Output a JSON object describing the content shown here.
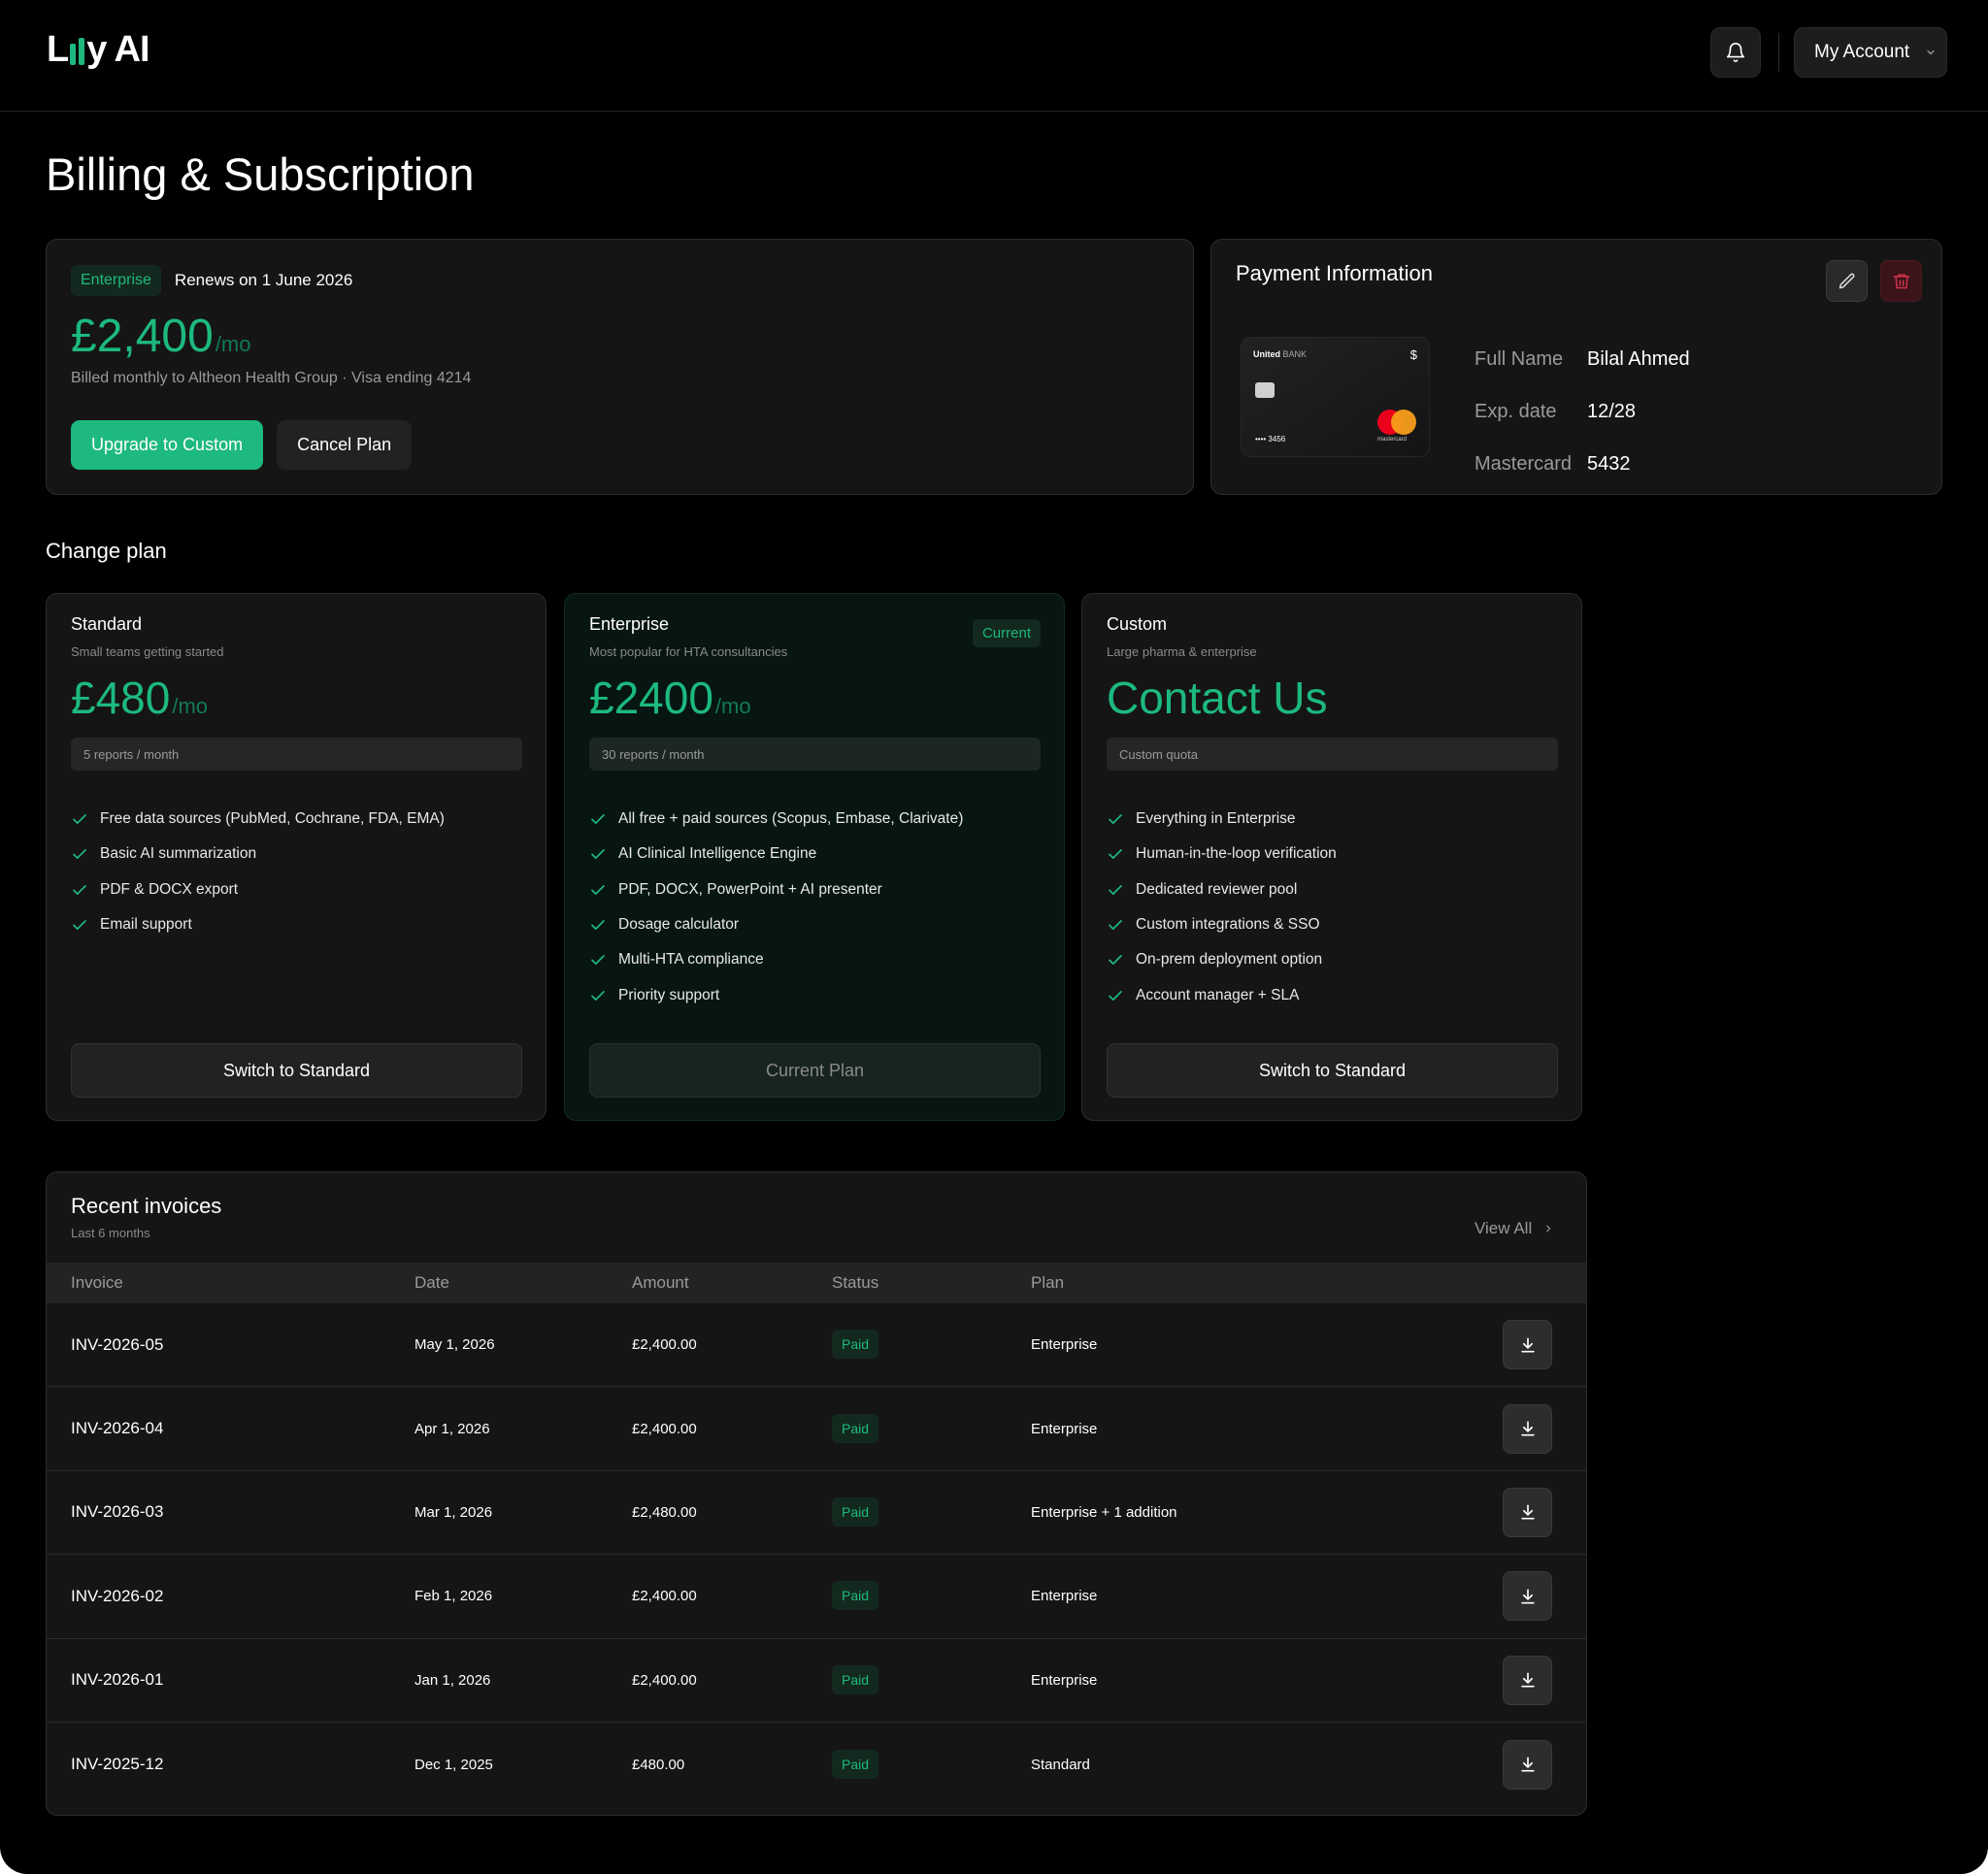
{
  "brand": {
    "name_pre": "L",
    "name_post": "y AI"
  },
  "header": {
    "account_label": "My Account",
    "bell_icon": "bell-icon",
    "chevron_icon": "chevron-down-icon"
  },
  "page_title": "Billing & Subscription",
  "subscription": {
    "plan_badge": "Enterprise",
    "renews": "Renews on 1 June 2026",
    "price": "£2,400",
    "unit": "/mo",
    "description": "Billed monthly to Altheon Health Group · Visa ending 4214",
    "upgrade_label": "Upgrade to Custom",
    "cancel_label": "Cancel Plan"
  },
  "payment": {
    "title": "Payment Information",
    "card": {
      "bank": "United",
      "bank_suffix": "BANK",
      "currency": "$",
      "masked": "•••• 3456",
      "network_text": "mastercard"
    },
    "rows": [
      {
        "label": "Full Name",
        "value": "Bilal Ahmed"
      },
      {
        "label": "Exp. date",
        "value": "12/28"
      },
      {
        "label": "Mastercard",
        "value": "5432"
      }
    ],
    "colors": {
      "accent": "#1db97f",
      "danger": "#d0324a"
    }
  },
  "change_plan": {
    "title": "Change plan",
    "plans": [
      {
        "name": "Standard",
        "subtitle": "Small teams getting started",
        "price": "£480",
        "unit": "/mo",
        "quota": "5 reports / month",
        "features": [
          "Free data sources (PubMed, Cochrane, FDA, EMA)",
          "Basic AI summarization",
          "PDF & DOCX export",
          "Email support"
        ],
        "button": "Switch to Standard"
      },
      {
        "name": "Enterprise",
        "subtitle": "Most popular for HTA consultancies",
        "badge": "Current",
        "price": "£2400",
        "unit": "/mo",
        "quota": "30 reports / month",
        "features": [
          "All free + paid sources (Scopus, Embase, Clarivate)",
          "AI Clinical Intelligence Engine",
          "PDF, DOCX, PowerPoint + AI presenter",
          "Dosage calculator",
          "Multi-HTA compliance",
          "Priority support"
        ],
        "button": "Current Plan"
      },
      {
        "name": "Custom",
        "subtitle": "Large pharma & enterprise",
        "price": "Contact Us",
        "unit": "",
        "quota": "Custom quota",
        "features": [
          "Everything in Enterprise",
          "Human-in-the-loop verification",
          "Dedicated reviewer pool",
          "Custom integrations & SSO",
          "On-prem deployment option",
          "Account manager + SLA"
        ],
        "button": "Switch to Standard"
      }
    ]
  },
  "invoices": {
    "title": "Recent invoices",
    "subtitle": "Last 6 months",
    "view_all": "View All",
    "columns": [
      "Invoice",
      "Date",
      "Amount",
      "Status",
      "Plan"
    ],
    "rows": [
      {
        "invoice": "INV-2026-05",
        "date": "May 1, 2026",
        "amount": "£2,400.00",
        "status": "Paid",
        "plan": "Enterprise"
      },
      {
        "invoice": "INV-2026-04",
        "date": "Apr 1, 2026",
        "amount": "£2,400.00",
        "status": "Paid",
        "plan": "Enterprise"
      },
      {
        "invoice": "INV-2026-03",
        "date": "Mar 1, 2026",
        "amount": "£2,480.00",
        "status": "Paid",
        "plan": "Enterprise + 1 addition"
      },
      {
        "invoice": "INV-2026-02",
        "date": "Feb 1, 2026",
        "amount": "£2,400.00",
        "status": "Paid",
        "plan": "Enterprise"
      },
      {
        "invoice": "INV-2026-01",
        "date": "Jan 1, 2026",
        "amount": "£2,400.00",
        "status": "Paid",
        "plan": "Enterprise"
      },
      {
        "invoice": "INV-2025-12",
        "date": "Dec 1, 2025",
        "amount": "£480.00",
        "status": "Paid",
        "plan": "Standard"
      }
    ]
  }
}
